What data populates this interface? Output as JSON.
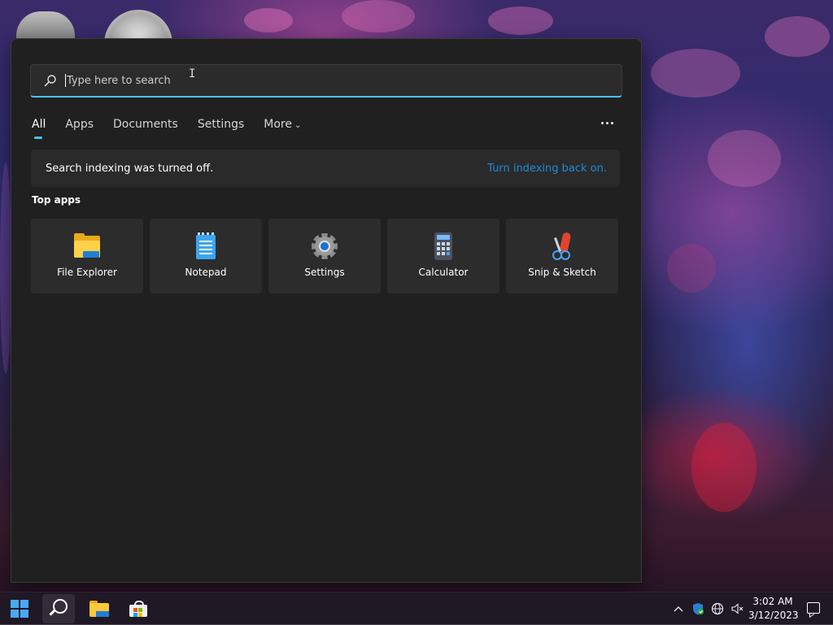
{
  "search": {
    "placeholder": "Type here to search",
    "value": ""
  },
  "tabs": [
    {
      "label": "All",
      "active": true
    },
    {
      "label": "Apps",
      "active": false
    },
    {
      "label": "Documents",
      "active": false
    },
    {
      "label": "Settings",
      "active": false
    },
    {
      "label": "More",
      "active": false
    }
  ],
  "notice": {
    "message": "Search indexing was turned off.",
    "link": "Turn indexing back on."
  },
  "top_apps": {
    "title": "Top apps",
    "items": [
      {
        "label": "File Explorer",
        "icon": "file-explorer-icon"
      },
      {
        "label": "Notepad",
        "icon": "notepad-icon"
      },
      {
        "label": "Settings",
        "icon": "settings-gear-icon"
      },
      {
        "label": "Calculator",
        "icon": "calculator-icon"
      },
      {
        "label": "Snip & Sketch",
        "icon": "snip-sketch-icon"
      }
    ]
  },
  "taskbar": {
    "items": [
      "start-windows-icon",
      "search-icon",
      "file-explorer-icon",
      "microsoft-store-icon"
    ],
    "tray": [
      "chevron-up-icon",
      "windows-security-icon",
      "network-globe-icon",
      "volume-muted-icon"
    ],
    "time": "3:02 AM",
    "date": "3/12/2023"
  },
  "colors": {
    "accent": "#4cc2ff",
    "link": "#1f8ad8",
    "flyout_bg": "#202020"
  }
}
